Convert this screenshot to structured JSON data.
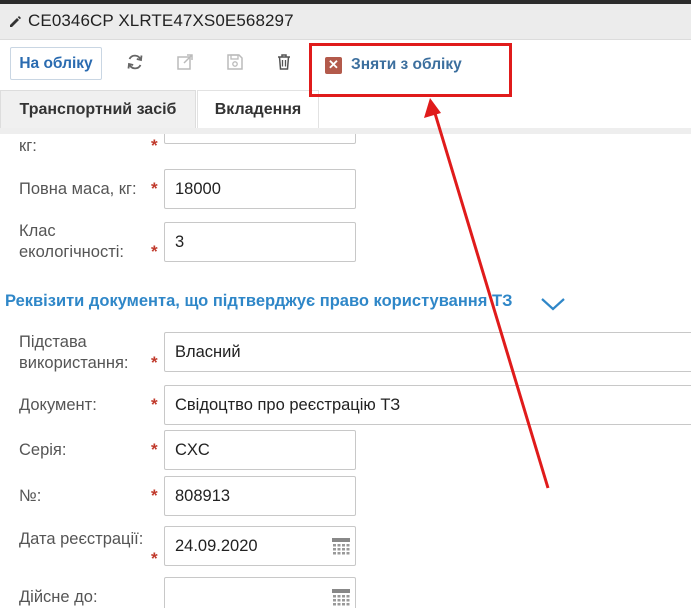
{
  "window": {
    "title": "CE0346CP XLRTE47XS0E568297"
  },
  "toolbar": {
    "status_label": "На обліку",
    "deregister_label": "Зняти з обліку"
  },
  "tabs": [
    {
      "label": "Транспортний засіб",
      "active": true
    },
    {
      "label": "Вкладення",
      "active": false
    }
  ],
  "vehicle": {
    "partial_label": "кг:",
    "full_mass_label": "Повна маса, кг:",
    "full_mass_value": "18000",
    "eco_class_label_1": "Клас",
    "eco_class_label_2": "екологічності:",
    "eco_class_value": "3"
  },
  "document_section": {
    "title": "Реквізити документа, що підтверджує право користування ТЗ",
    "basis_label_1": "Підстава",
    "basis_label_2": "використання:",
    "basis_value": "Власний",
    "doc_label": "Документ:",
    "doc_value": "Свідоцтво про реєстрацію ТЗ",
    "series_label": "Серія:",
    "series_value": "CXC",
    "number_label": "№:",
    "number_value": "808913",
    "reg_date_label": "Дата реєстрації:",
    "reg_date_value": "24.09.2020",
    "valid_until_label": "Дійсне до:",
    "valid_until_value": ""
  },
  "required_marker": "*",
  "colors": {
    "accent": "#2f87c8",
    "annotation": "#e01b1b",
    "danger": "#b35a4b"
  }
}
